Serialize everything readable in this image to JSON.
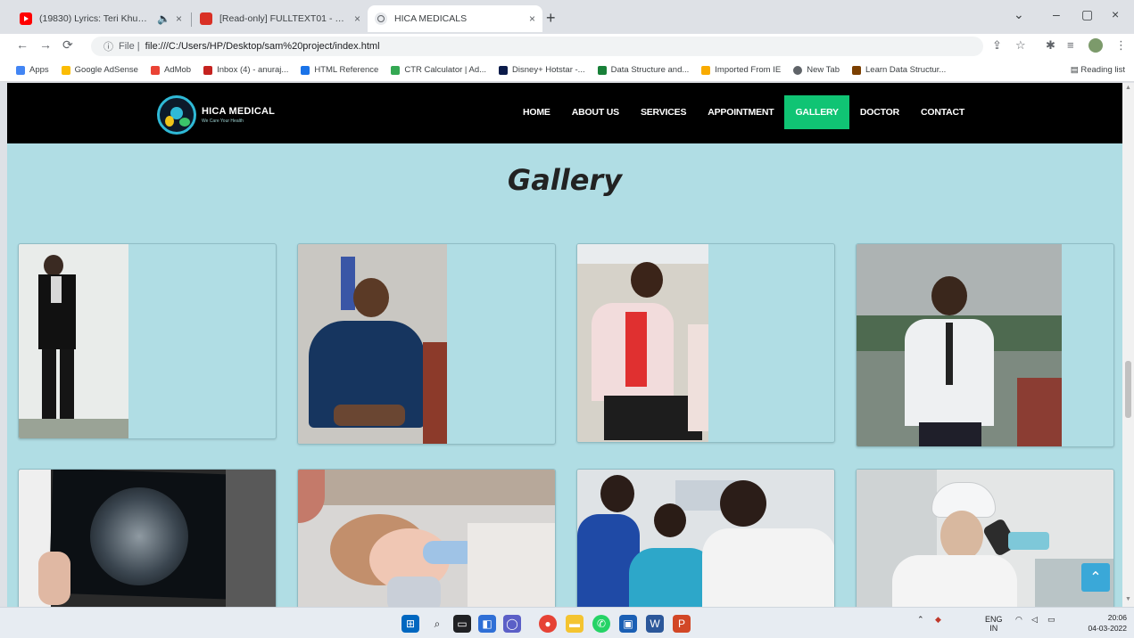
{
  "browser": {
    "tabs": [
      {
        "label": "(19830) Lyrics: Teri Khushbu",
        "favicon_color": "#ff0000",
        "active": false
      },
      {
        "label": "[Read-only] FULLTEXT01 - Compat",
        "favicon_color": "#d93025",
        "active": false
      },
      {
        "label": "HICA MEDICALS",
        "favicon_color": "#5f6368",
        "active": true
      }
    ],
    "address": {
      "scheme": "File |",
      "url": "file:///C:/Users/HP/Desktop/sam%20project/index.html"
    },
    "bookmarks": [
      {
        "label": "Apps",
        "color": "#4285f4"
      },
      {
        "label": "Google AdSense",
        "color": "#fbbc04"
      },
      {
        "label": "AdMob",
        "color": "#ea4335"
      },
      {
        "label": "Inbox (4) - anuraj...",
        "color": "#c5221f"
      },
      {
        "label": "HTML Reference",
        "color": "#1a73e8"
      },
      {
        "label": "CTR Calculator | Ad...",
        "color": "#34a853"
      },
      {
        "label": "Disney+ Hotstar -...",
        "color": "#0b1b4a"
      },
      {
        "label": "Data Structure and...",
        "color": "#188038"
      },
      {
        "label": "Imported From IE",
        "color": "#f9ab00"
      },
      {
        "label": "New Tab",
        "color": "#5f6368"
      },
      {
        "label": "Learn Data Structur...",
        "color": "#7b3f00"
      }
    ],
    "reading_list": "Reading list"
  },
  "site": {
    "logo_name": "HICA MEDICAL",
    "logo_tagline": "We Care Your Health",
    "menu": [
      {
        "label": "HOME",
        "active": false
      },
      {
        "label": "ABOUT US",
        "active": false
      },
      {
        "label": "SERVICES",
        "active": false
      },
      {
        "label": "APPOINTMENT",
        "active": false
      },
      {
        "label": "GALLERY",
        "active": true
      },
      {
        "label": "DOCTOR",
        "active": false
      },
      {
        "label": "CONTACT",
        "active": false
      }
    ],
    "gallery_title": "Gallery",
    "colors": {
      "accent": "#10c474",
      "page_bg": "#b0dde4",
      "nav_bg": "#000000",
      "back_to_top": "#3aa8d8"
    }
  },
  "taskbar": {
    "language": "ENG",
    "region": "IN",
    "time": "20:06",
    "date": "04-03-2022"
  }
}
